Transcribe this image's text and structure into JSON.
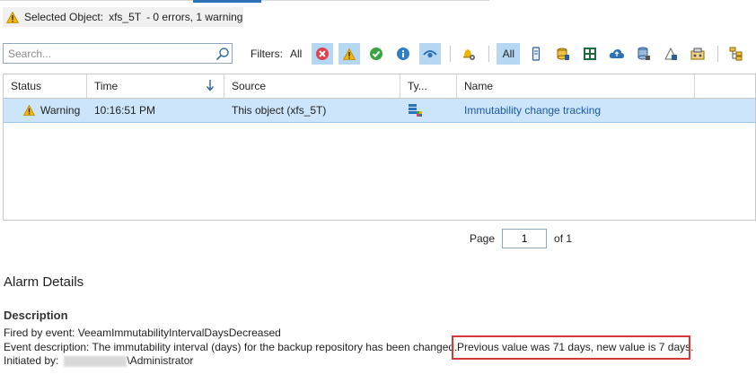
{
  "selected_object": {
    "label": "Selected Object:",
    "name": "xfs_5T",
    "summary": "- 0 errors, 1 warning"
  },
  "search": {
    "placeholder": "Search..."
  },
  "filters": {
    "label": "Filters:",
    "all_label": "All",
    "status_filters": [
      "error-icon",
      "warning-icon",
      "success-icon",
      "info-icon",
      "visibility-icon"
    ],
    "type_all_label": "All"
  },
  "grid": {
    "columns": [
      "Status",
      "Time",
      "Source",
      "Ty...",
      "Name"
    ],
    "rows": [
      {
        "status": "Warning",
        "time": "10:16:51 PM",
        "source": "This object (xfs_5T)",
        "type_icon": "repository-type-icon",
        "name": "Immutability change tracking"
      }
    ]
  },
  "pager": {
    "page_label": "Page",
    "page_value": "1",
    "of_label": "of 1"
  },
  "details": {
    "title": "Alarm Details",
    "description_heading": "Description",
    "fired_by": "Fired by event: VeeamImmutabilityIntervalDaysDecreased",
    "event_description": "Event description: The immutability interval (days) for the backup repository has been changed.",
    "highlighted": "Previous value was 71 days, new value is 7 days.",
    "initiated_by_label": "Initiated by:",
    "initiated_by_user": "\\Administrator"
  },
  "colors": {
    "accent": "#2b72b8",
    "selected_row": "#cce5fb",
    "highlight_border": "#d43a3a",
    "link": "#1a5aa8"
  }
}
